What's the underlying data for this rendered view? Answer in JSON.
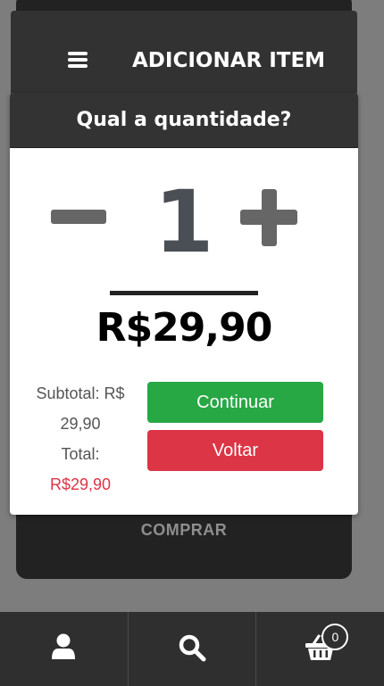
{
  "header": {
    "title": "ADICIONAR ITEM",
    "menu_icon": "hamburger-menu-icon"
  },
  "dialog": {
    "title": "Qual a quantidade?",
    "quantity": "1",
    "price": "R$29,90",
    "subtotal_label": "Subtotal: R$",
    "subtotal_value": "29,90",
    "total_label": "Total:",
    "total_value": "R$29,90",
    "continue_label": "Continuar",
    "back_label": "Voltar"
  },
  "background": {
    "buy_label": "COMPRAR"
  },
  "bottom_nav": {
    "items": [
      {
        "icon": "user-icon"
      },
      {
        "icon": "search-icon"
      },
      {
        "icon": "basket-icon",
        "badge": "0"
      }
    ]
  },
  "colors": {
    "continue": "#28a745",
    "back": "#dc3545",
    "header": "#323232",
    "total_value": "#dc3545"
  }
}
